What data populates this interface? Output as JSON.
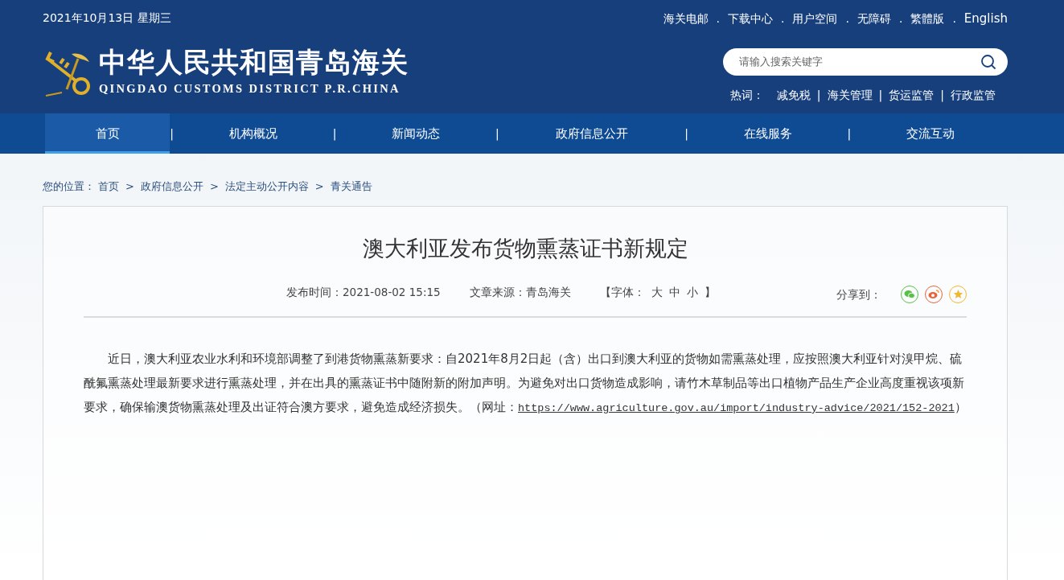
{
  "top_bar": {
    "date": "2021年10月13日 星期三",
    "separator": ".",
    "links": [
      "海关电邮",
      "下载中心",
      "用户空间",
      "无障碍",
      "繁體版",
      "English"
    ]
  },
  "logo": {
    "title": "中华人民共和国青岛海关",
    "subtitle": "QINGDAO CUSTOMS DISTRICT P.R.CHINA"
  },
  "search": {
    "placeholder": "请输入搜索关键字"
  },
  "hot_words": {
    "label": "热词：",
    "separator": "|",
    "items": [
      "减免税",
      "海关管理",
      "货运监管",
      "行政监管"
    ]
  },
  "nav": {
    "separator": "|",
    "items": [
      {
        "label": "首页",
        "selected": true
      },
      {
        "label": "机构概况",
        "selected": false
      },
      {
        "label": "新闻动态",
        "selected": false
      },
      {
        "label": "政府信息公开",
        "selected": false
      },
      {
        "label": "在线服务",
        "selected": false
      },
      {
        "label": "交流互动",
        "selected": false
      }
    ]
  },
  "breadcrumb": {
    "label": "您的位置：",
    "separator": ">",
    "items": [
      "首页",
      "政府信息公开",
      "法定主动公开内容",
      "青关通告"
    ]
  },
  "article": {
    "title": "澳大利亚发布货物熏蒸证书新规定",
    "publish_time": "发布时间：2021-08-02 15:15",
    "source": "文章来源：青岛海关",
    "font_size": {
      "open": "【字体：",
      "options": [
        "大",
        "中",
        "小"
      ],
      "close": "】"
    },
    "share_label": "分享到：",
    "body": {
      "text": "近日，澳大利亚农业水利和环境部调整了到港货物熏蒸新要求：自2021年8月2日起（含）出口到澳大利亚的货物如需熏蒸处理，应按照澳大利亚针对溴甲烷、硫酰氟熏蒸处理最新要求进行熏蒸处理，并在出具的熏蒸证书中随附新的附加声明。为避免对出口货物造成影响，请竹木草制品等出口植物产品生产企业高度重视该项新要求，确保输澳货物熏蒸处理及出证符合澳方要求，避免造成经济损失。（网址：",
      "link": "https://www.agriculture.gov.au/import/industry-advice/2021/152-2021",
      "after": "）"
    }
  }
}
